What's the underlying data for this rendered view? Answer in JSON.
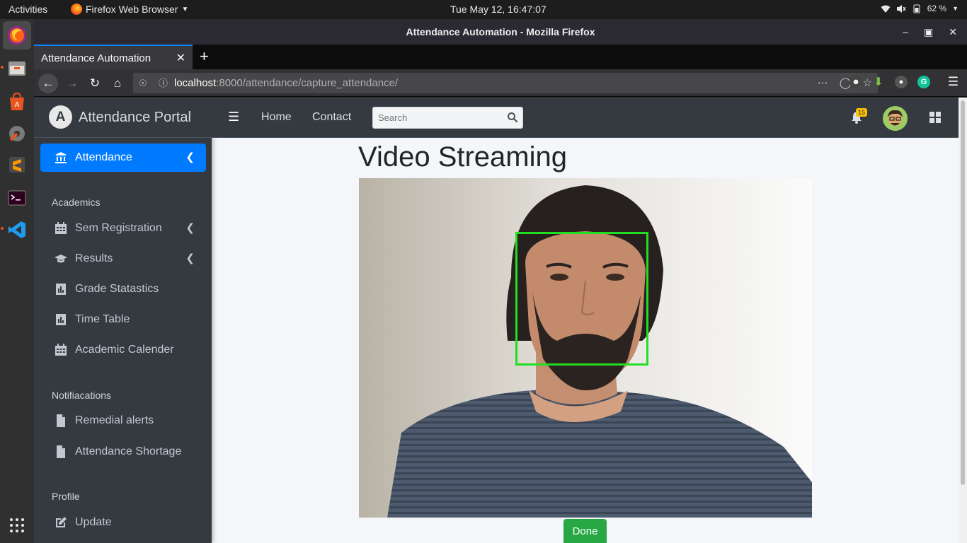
{
  "system": {
    "activities": "Activities",
    "app_menu": "Firefox Web Browser",
    "clock": "Tue May 12, 16:47:07",
    "battery": "62 %"
  },
  "dock": {
    "items": [
      "firefox-icon",
      "files-icon",
      "software-center-icon",
      "settings-icon",
      "sublime-text-icon",
      "terminal-icon",
      "vscode-icon",
      "app-grid-icon"
    ]
  },
  "browser": {
    "window_title": "Attendance Automation - Mozilla Firefox",
    "tab_title": "Attendance Automation",
    "url_host": "localhost",
    "url_rest": ":8000/attendance/capture_attendance/"
  },
  "sidebar": {
    "brand": "Attendance Portal",
    "brand_logo": "A",
    "active_item": "Attendance",
    "sections": [
      {
        "header": "Academics",
        "items": [
          "Sem Registration",
          "Results",
          "Grade Statastics",
          "Time Table",
          "Academic Calender"
        ]
      },
      {
        "header": "Notifiacations",
        "items": [
          "Remedial alerts",
          "Attendance Shortage"
        ]
      },
      {
        "header": "Profile",
        "items": [
          "Update"
        ]
      }
    ]
  },
  "header": {
    "links": [
      "Home",
      "Contact"
    ],
    "search_placeholder": "Search",
    "notification_count": "15"
  },
  "main": {
    "title": "Video Streaming",
    "done_label": "Done"
  },
  "colors": {
    "sidebar_bg": "#343a40",
    "active": "#007bff",
    "done": "#28a745",
    "face_box": "#22dd22"
  }
}
